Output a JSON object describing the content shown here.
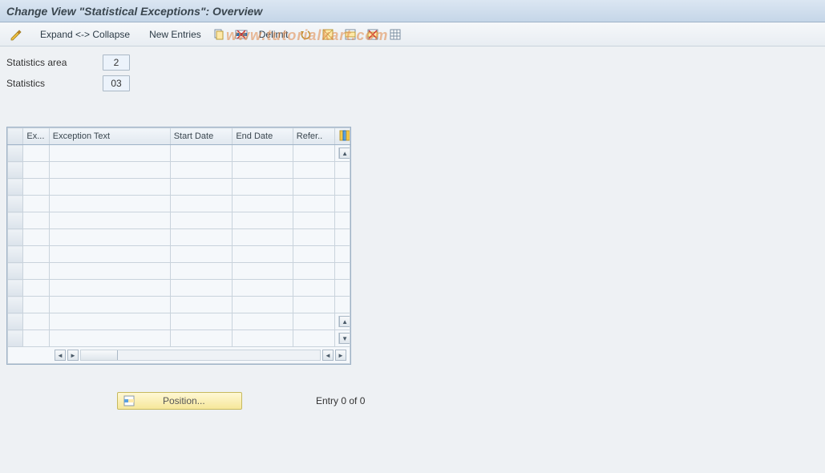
{
  "title": "Change View \"Statistical Exceptions\": Overview",
  "watermark": "www.tutorialkart.com",
  "toolbar": {
    "expand_collapse": "Expand <-> Collapse",
    "new_entries": "New Entries",
    "delimit": "Delimit"
  },
  "fields": {
    "stat_area_label": "Statistics area",
    "stat_area_value": "2",
    "statistics_label": "Statistics",
    "statistics_value": "03"
  },
  "table": {
    "columns": {
      "ex": "Ex...",
      "text": "Exception Text",
      "start": "Start Date",
      "end": "End Date",
      "ref": "Refer.."
    },
    "rows": [
      "",
      "",
      "",
      "",
      "",
      "",
      "",
      "",
      "",
      "",
      "",
      ""
    ]
  },
  "footer": {
    "position_label": "Position...",
    "entry_text": "Entry 0 of 0"
  }
}
